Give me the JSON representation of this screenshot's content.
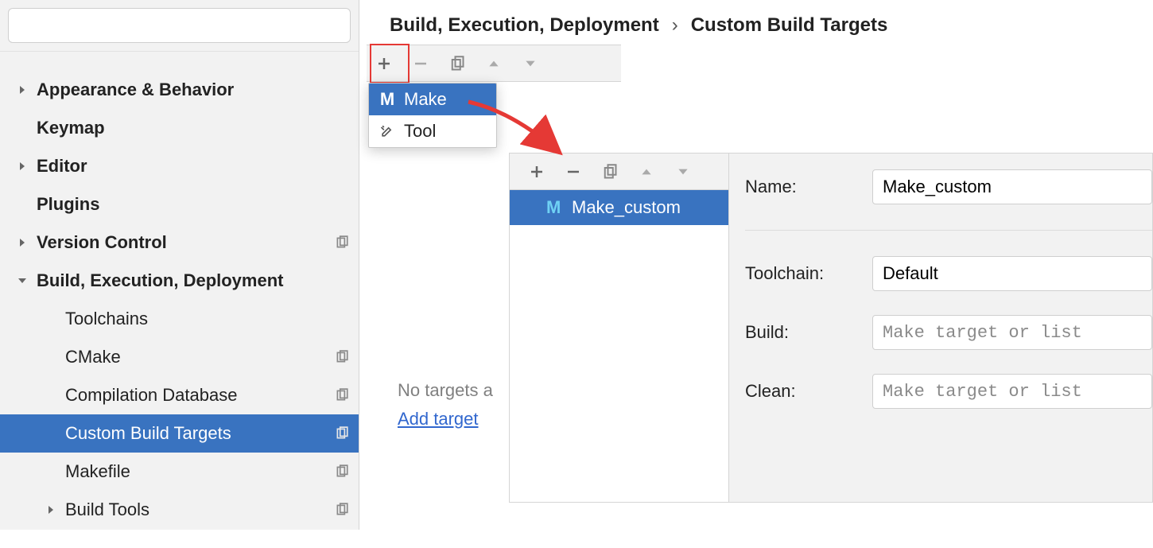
{
  "breadcrumb": {
    "a": "Build, Execution, Deployment",
    "sep": "›",
    "b": "Custom Build Targets"
  },
  "sidebar": {
    "search_placeholder": "",
    "items": [
      {
        "label": "Appearance & Behavior",
        "bold": true,
        "expandable": true
      },
      {
        "label": "Keymap",
        "bold": true,
        "expandable": false
      },
      {
        "label": "Editor",
        "bold": true,
        "expandable": true
      },
      {
        "label": "Plugins",
        "bold": true,
        "expandable": false
      },
      {
        "label": "Version Control",
        "bold": true,
        "expandable": true,
        "copy": true
      },
      {
        "label": "Build, Execution, Deployment",
        "bold": true,
        "expandable": true,
        "expanded": true
      },
      {
        "label": "Toolchains",
        "indent": 2
      },
      {
        "label": "CMake",
        "indent": 2,
        "copy": true
      },
      {
        "label": "Compilation Database",
        "indent": 2,
        "copy": true
      },
      {
        "label": "Custom Build Targets",
        "indent": 2,
        "copy": true,
        "selected": true
      },
      {
        "label": "Makefile",
        "indent": 2,
        "copy": true
      },
      {
        "label": "Build Tools",
        "indent": 2,
        "expandable": true,
        "copy": true
      }
    ]
  },
  "popup": {
    "items": [
      {
        "label": "Make",
        "icon": "M",
        "selected": true
      },
      {
        "label": "Tool",
        "icon": "tools"
      }
    ]
  },
  "emptyA": {
    "msg": "No targets a",
    "link": "Add target"
  },
  "panelB": {
    "list": [
      {
        "label": "Make_custom",
        "selected": true
      }
    ],
    "form": {
      "name_label": "Name:",
      "name_value": "Make_custom",
      "toolchain_label": "Toolchain:",
      "toolchain_value": "Default",
      "build_label": "Build:",
      "build_placeholder": "Make target or list",
      "clean_label": "Clean:",
      "clean_placeholder": "Make target or list"
    }
  }
}
